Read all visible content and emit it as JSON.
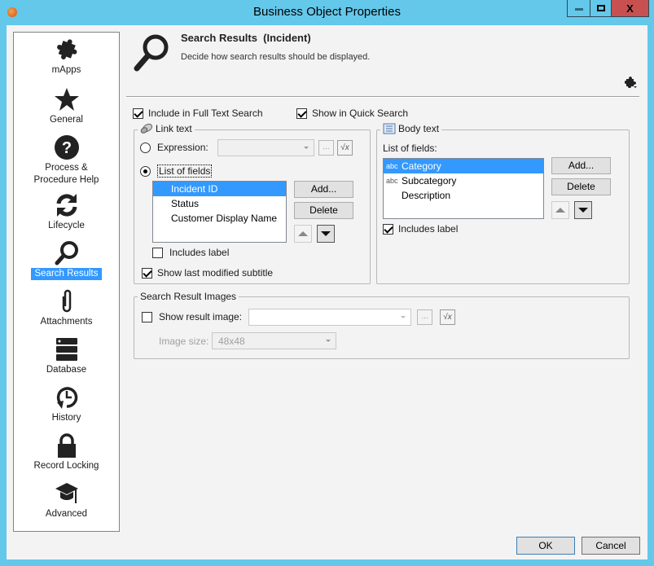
{
  "window": {
    "title": "Business Object Properties",
    "close_label": "X"
  },
  "sidebar": {
    "items": [
      {
        "label": "mApps",
        "icon": "puzzle-icon"
      },
      {
        "label": "General",
        "icon": "star-icon"
      },
      {
        "label": "Process & Procedure Help",
        "icon": "help-icon"
      },
      {
        "label": "Lifecycle",
        "icon": "refresh-icon"
      },
      {
        "label": "Search Results",
        "icon": "search-icon",
        "selected": true
      },
      {
        "label": "Attachments",
        "icon": "paperclip-icon"
      },
      {
        "label": "Database",
        "icon": "database-icon"
      },
      {
        "label": "History",
        "icon": "history-icon"
      },
      {
        "label": "Record Locking",
        "icon": "lock-icon"
      },
      {
        "label": "Advanced",
        "icon": "graduation-cap-icon"
      }
    ]
  },
  "header": {
    "title": "Search Results  (Incident)",
    "subtitle": "Decide how search results should be displayed."
  },
  "options": {
    "full_text_search": {
      "label": "Include in Full Text Search",
      "checked": true
    },
    "quick_search": {
      "label": "Show in Quick Search",
      "checked": true
    }
  },
  "link_text": {
    "legend": "Link text",
    "expression_label": "Expression:",
    "expression_value": "",
    "expression_selected": false,
    "list_of_fields_label": "List of fields",
    "list_of_fields_selected": true,
    "fields": [
      "Incident ID",
      "Status",
      "Customer Display Name"
    ],
    "selected_field": "Incident ID",
    "add_label": "Add...",
    "delete_label": "Delete",
    "ellipsis_label": "...",
    "fx_label": "√x",
    "includes_label": {
      "label": "Includes label",
      "checked": false
    },
    "show_last_modified": {
      "label": "Show last modified subtitle",
      "checked": true
    }
  },
  "body_text": {
    "legend": "Body text",
    "list_label": "List of fields:",
    "fields": [
      {
        "label": "Category",
        "type": "abc"
      },
      {
        "label": "Subcategory",
        "type": "abc"
      },
      {
        "label": "Description",
        "type": ""
      }
    ],
    "selected_field": "Category",
    "add_label": "Add...",
    "delete_label": "Delete",
    "includes_label": {
      "label": "Includes label",
      "checked": true
    }
  },
  "images": {
    "legend": "Search Result Images",
    "show_label": "Show result image:",
    "show_checked": false,
    "image_value": "",
    "ellipsis_label": "...",
    "fx_label": "√x",
    "size_label": "Image size:",
    "size_value": "48x48"
  },
  "footer": {
    "ok_label": "OK",
    "cancel_label": "Cancel"
  }
}
